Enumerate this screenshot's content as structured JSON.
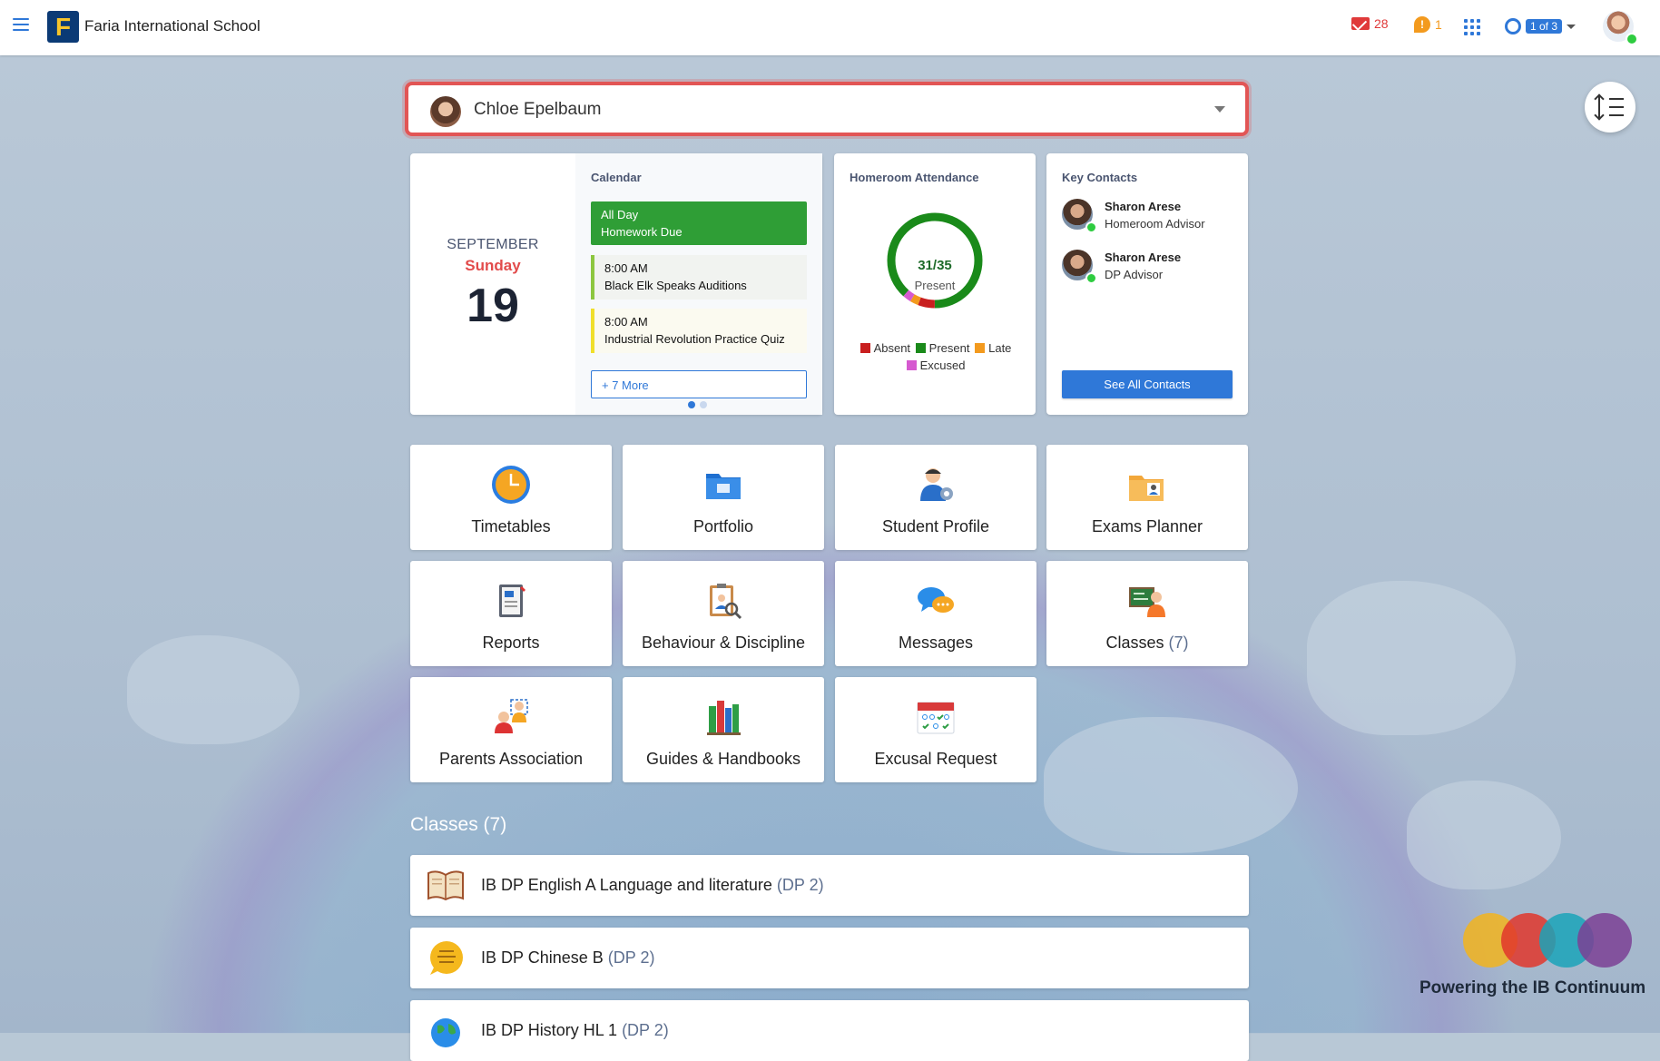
{
  "app": {
    "school_name": "Faria International School",
    "logo_letter": "F"
  },
  "topbar": {
    "messages_count": "28",
    "alerts_count": "1",
    "alert_glyph": "!",
    "account_switch": "1 of 3"
  },
  "student_selector": {
    "name": "Chloe Epelbaum"
  },
  "date_widget": {
    "month": "SEPTEMBER",
    "weekday": "Sunday",
    "day": "19"
  },
  "calendar": {
    "title": "Calendar",
    "events": [
      {
        "time": "All Day",
        "title": "Homework Due",
        "color": "#2f9e36"
      },
      {
        "time": "8:00 AM",
        "title": "Black Elk Speaks Auditions",
        "color": "#8cc63f"
      },
      {
        "time": "8:00 AM",
        "title": "Industrial Revolution Practice Quiz",
        "color": "#f0df2b"
      }
    ],
    "more_label": "+ 7 More",
    "page": 1,
    "pages": 2
  },
  "attendance": {
    "title": "Homeroom Attendance",
    "present": 31,
    "total": 35,
    "fraction_label": "31/35",
    "status_label": "Present",
    "segments": {
      "present": 31,
      "absent": 2,
      "late": 1,
      "excused": 1
    },
    "legend": [
      {
        "label": "Absent",
        "color": "#c91f1f"
      },
      {
        "label": "Present",
        "color": "#1a8a1a"
      },
      {
        "label": "Late",
        "color": "#f39a1e"
      },
      {
        "label": "Excused",
        "color": "#d65ad0"
      }
    ]
  },
  "key_contacts": {
    "title": "Key Contacts",
    "contacts": [
      {
        "name": "Sharon Arese",
        "role": "Homeroom Advisor"
      },
      {
        "name": "Sharon Arese",
        "role": "DP Advisor"
      }
    ],
    "see_all_label": "See All Contacts"
  },
  "tiles": [
    {
      "label": "Timetables",
      "icon": "clock-icon"
    },
    {
      "label": "Portfolio",
      "icon": "folder-icon"
    },
    {
      "label": "Student Profile",
      "icon": "student-profile-icon"
    },
    {
      "label": "Exams Planner",
      "icon": "exams-folder-icon"
    },
    {
      "label": "Reports",
      "icon": "report-cards-icon"
    },
    {
      "label": "Behaviour & Discipline",
      "icon": "clipboard-magnifier-icon"
    },
    {
      "label": "Messages",
      "icon": "chat-bubbles-icon"
    },
    {
      "label": "Classes",
      "count": "(7)",
      "icon": "classroom-board-icon"
    },
    {
      "label": "Parents Association",
      "icon": "people-icon"
    },
    {
      "label": "Guides & Handbooks",
      "icon": "books-icon"
    },
    {
      "label": "Excusal Request",
      "icon": "attendance-calendar-icon"
    }
  ],
  "classes_section": {
    "title": "Classes (7)",
    "classes": [
      {
        "name": "IB DP English A Language and literature",
        "grade": "(DP 2)",
        "icon": "open-book-icon"
      },
      {
        "name": "IB DP Chinese B",
        "grade": "(DP 2)",
        "icon": "language-bubble-icon"
      },
      {
        "name": "IB DP History HL 1",
        "grade": "(DP 2)",
        "icon": "globe-icon"
      }
    ]
  },
  "branding": {
    "tagline": "Powering the IB Continuum",
    "colors": [
      "#f2b41d",
      "#e0362c",
      "#1aa3b8",
      "#7b3f94"
    ]
  }
}
